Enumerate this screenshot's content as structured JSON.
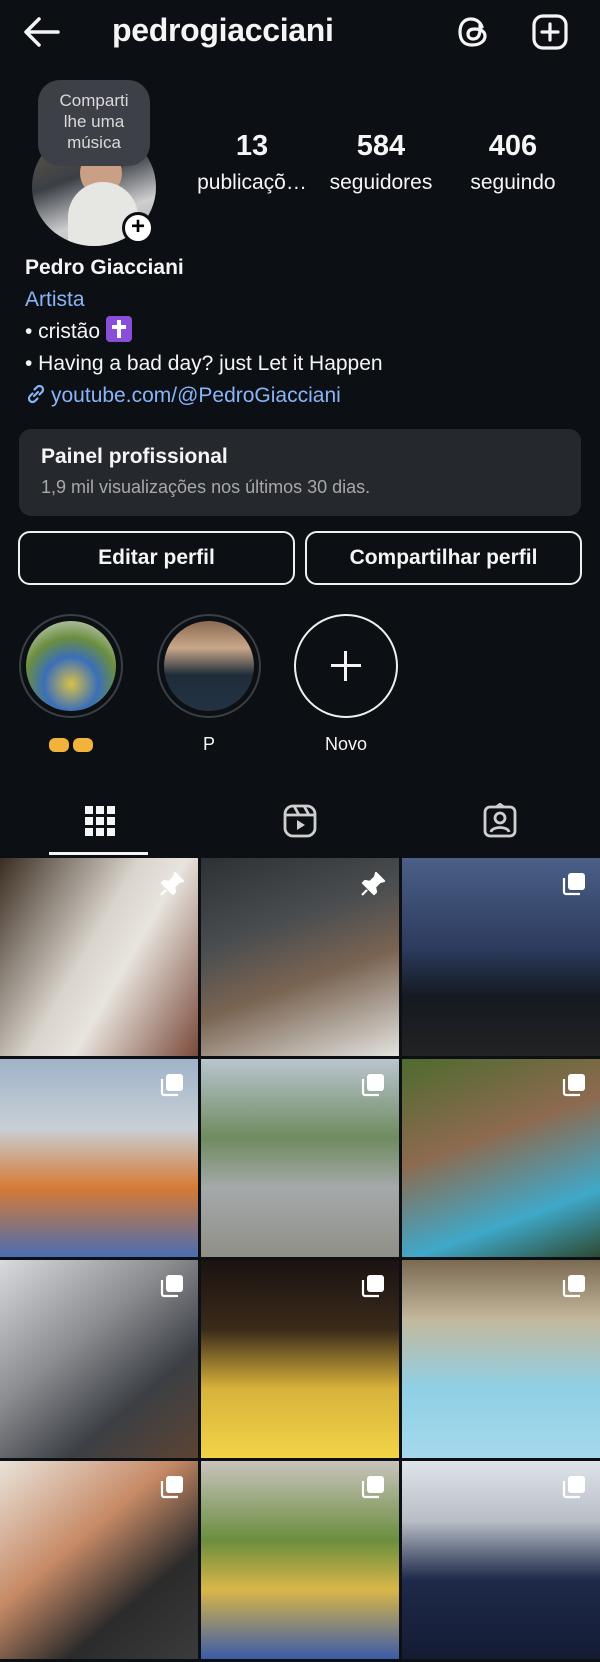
{
  "header": {
    "username": "pedrogiacciani",
    "back_icon": "arrow-left-icon",
    "threads_icon": "threads-icon",
    "add_icon": "plus-square-icon"
  },
  "profile": {
    "music_bubble": [
      "Comparti",
      "lhe uma",
      "música"
    ],
    "stats": {
      "posts": {
        "value": "13",
        "label": "publicaçõ…"
      },
      "followers": {
        "value": "584",
        "label": "seguidores"
      },
      "following": {
        "value": "406",
        "label": "seguindo"
      }
    },
    "name": "Pedro Giacciani",
    "category": "Artista",
    "bio_lines": [
      "• cristão",
      "• Having a bad day? just Let it Happen"
    ],
    "link": "youtube.com/@PedroGiacciani"
  },
  "panel": {
    "title": "Painel profissional",
    "subtitle": "1,9 mil visualizações nos últimos 30 dias."
  },
  "buttons": {
    "edit": "Editar perfil",
    "share": "Compartilhar perfil"
  },
  "highlights": [
    {
      "label": ""
    },
    {
      "label": "P"
    },
    {
      "label": "Novo"
    }
  ],
  "tabs": [
    "grid-icon",
    "reels-icon",
    "tagged-icon"
  ],
  "colors": {
    "background": "#0c1014",
    "link": "#8ab4f8",
    "panel": "#25292e"
  }
}
